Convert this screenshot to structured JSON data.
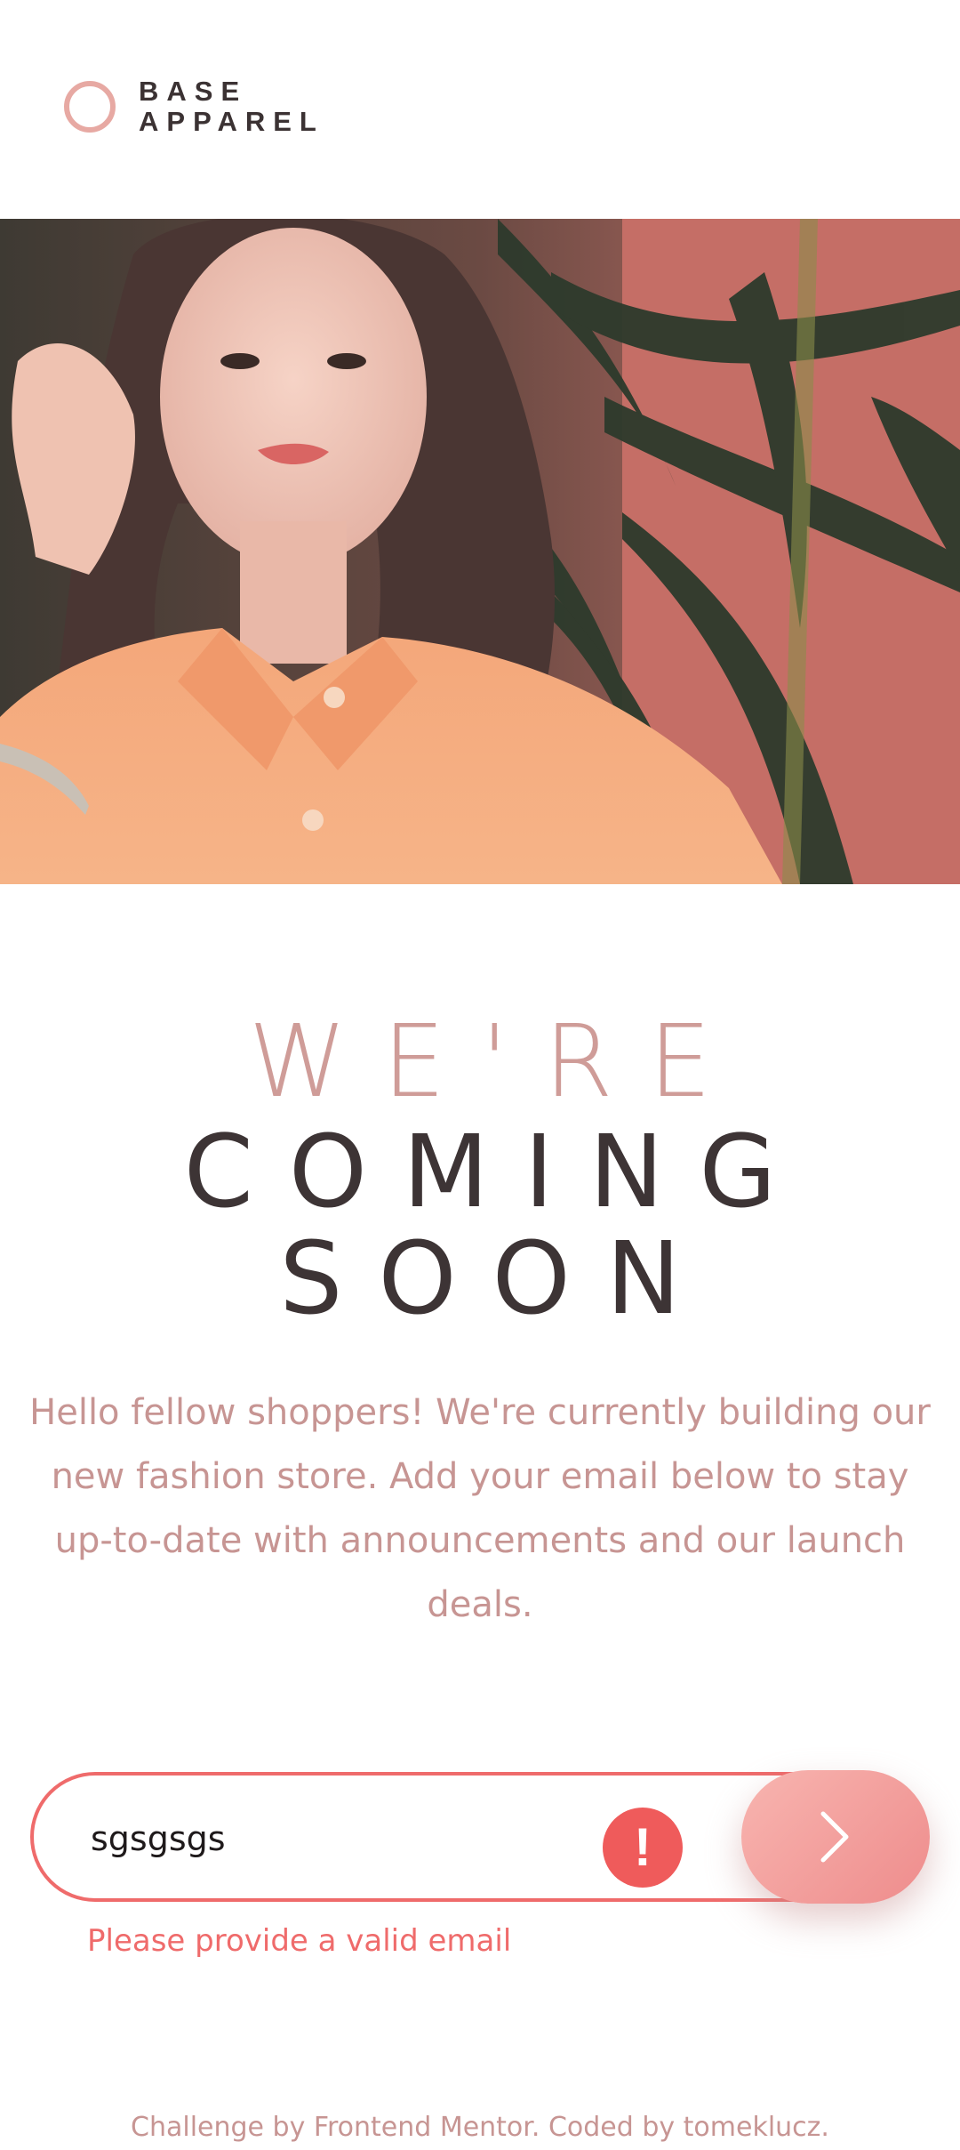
{
  "brand": {
    "line1": "BASE",
    "line2": "APPAREL",
    "accent": "#e7a9a3"
  },
  "hero": {
    "icon": "model-photo"
  },
  "headline": {
    "line1": "WE'RE",
    "line2": "COMING",
    "line3": "SOON"
  },
  "description": "Hello fellow shoppers! We're currently building our new fashion store. Add your email below to stay up-to-date with announcements and our launch deals.",
  "form": {
    "email_value": "sgsgsgs",
    "error_icon": "!",
    "submit_icon": "chevron-right-icon",
    "error_message": "Please provide a valid email",
    "error_color": "#ef6b6b"
  },
  "footer": {
    "text": "Challenge by Frontend Mentor. Coded by tomeklucz."
  }
}
